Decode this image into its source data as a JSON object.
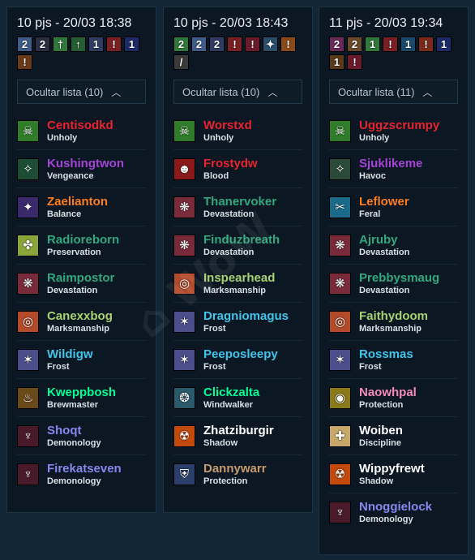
{
  "columns": [
    {
      "title": "10 pjs - 20/03 18:38",
      "toggle_label": "Ocultar lista (10)",
      "badges": [
        {
          "text": "2",
          "color": "#3f5d8a",
          "icon": "dk-rune-2"
        },
        {
          "text": "2",
          "color": "#2a2f45",
          "icon": "rune-2"
        },
        {
          "text": "†",
          "color": "#2f7a3a",
          "icon": "sword-icon"
        },
        {
          "text": "↑",
          "color": "#265e33",
          "icon": "green-arrow-icon"
        },
        {
          "text": "1",
          "color": "#2e3d63",
          "icon": "rune-1"
        },
        {
          "text": "!",
          "color": "#7a1f24",
          "icon": "red-mark-icon"
        },
        {
          "text": "1",
          "color": "#1c2c6b",
          "icon": "purple-rune-1"
        },
        {
          "text": "!",
          "color": "#6b3a1a",
          "icon": "orange-mark-icon"
        }
      ],
      "players": [
        {
          "name": "Centisodkd",
          "spec": "Unholy",
          "color": "#e8242f",
          "icon_bg": "#2f7d2a",
          "glyph": "☠",
          "icon": "unholy-icon"
        },
        {
          "name": "Kushingtwon",
          "spec": "Vengeance",
          "color": "#a544d6",
          "icon_bg": "#1d4e35",
          "glyph": "✧",
          "icon": "vengeance-icon"
        },
        {
          "name": "Zaelianton",
          "spec": "Balance",
          "color": "#ff7d1a",
          "icon_bg": "#3a2a6b",
          "glyph": "✦",
          "icon": "balance-icon"
        },
        {
          "name": "Radioreborn",
          "spec": "Preservation",
          "color": "#2fa87e",
          "icon_bg": "#8aa63a",
          "glyph": "✤",
          "icon": "preservation-icon"
        },
        {
          "name": "Raimpostor",
          "spec": "Devastation",
          "color": "#2fa87e",
          "icon_bg": "#7a2b3a",
          "glyph": "❋",
          "icon": "devastation-icon"
        },
        {
          "name": "Canexxbog",
          "spec": "Marksmanship",
          "color": "#a9d271",
          "icon_bg": "#b34a2a",
          "glyph": "◎",
          "icon": "marksmanship-icon"
        },
        {
          "name": "Wildigw",
          "spec": "Frost",
          "color": "#3fc6ea",
          "icon_bg": "#4a4f8c",
          "glyph": "✶",
          "icon": "frost-icon"
        },
        {
          "name": "Kweppbosh",
          "spec": "Brewmaster",
          "color": "#00ff96",
          "icon_bg": "#6b4a1a",
          "glyph": "♨",
          "icon": "brewmaster-icon"
        },
        {
          "name": "Shoqt",
          "spec": "Demonology",
          "color": "#8788ee",
          "icon_bg": "#4a1a2a",
          "glyph": "♆",
          "icon": "demonology-icon"
        },
        {
          "name": "Firekatseven",
          "spec": "Demonology",
          "color": "#8788ee",
          "icon_bg": "#4a1a2a",
          "glyph": "♆",
          "icon": "demonology-icon"
        }
      ]
    },
    {
      "title": "10 pjs - 20/03 18:43",
      "toggle_label": "Ocultar lista (10)",
      "badges": [
        {
          "text": "2",
          "color": "#2f7a3a",
          "icon": "green-rune-2"
        },
        {
          "text": "2",
          "color": "#3f5d8a",
          "icon": "dk-rune-2"
        },
        {
          "text": "2",
          "color": "#2e3d63",
          "icon": "rune-2"
        },
        {
          "text": "!",
          "color": "#7a1f24",
          "icon": "red-mark-icon"
        },
        {
          "text": "!",
          "color": "#6b1a2a",
          "icon": "red-mark-icon"
        },
        {
          "text": "✦",
          "color": "#2a4f6b",
          "icon": "ice-icon"
        },
        {
          "text": "!",
          "color": "#8a4a1a",
          "icon": "orange-mark-icon"
        },
        {
          "text": "/",
          "color": "#3a3a3a",
          "icon": "blade-icon"
        }
      ],
      "players": [
        {
          "name": "Worstxd",
          "spec": "Unholy",
          "color": "#e8242f",
          "icon_bg": "#2f7d2a",
          "glyph": "☠",
          "icon": "unholy-icon"
        },
        {
          "name": "Frostydw",
          "spec": "Blood",
          "color": "#e8242f",
          "icon_bg": "#8a1a1a",
          "glyph": "☻",
          "icon": "blood-icon"
        },
        {
          "name": "Thanervoker",
          "spec": "Devastation",
          "color": "#2fa87e",
          "icon_bg": "#7a2b3a",
          "glyph": "❋",
          "icon": "devastation-icon"
        },
        {
          "name": "Finduzbreath",
          "spec": "Devastation",
          "color": "#2fa87e",
          "icon_bg": "#7a2b3a",
          "glyph": "❋",
          "icon": "devastation-icon"
        },
        {
          "name": "Inspearhead",
          "spec": "Marksmanship",
          "color": "#a9d271",
          "icon_bg": "#b34a2a",
          "glyph": "◎",
          "icon": "marksmanship-icon"
        },
        {
          "name": "Dragniomagus",
          "spec": "Frost",
          "color": "#3fc6ea",
          "icon_bg": "#4a4f8c",
          "glyph": "✶",
          "icon": "frost-icon"
        },
        {
          "name": "Peeposleepy",
          "spec": "Frost",
          "color": "#3fc6ea",
          "icon_bg": "#4a4f8c",
          "glyph": "✶",
          "icon": "frost-icon"
        },
        {
          "name": "Clickzalta",
          "spec": "Windwalker",
          "color": "#00ff96",
          "icon_bg": "#2a5a6b",
          "glyph": "❂",
          "icon": "windwalker-icon"
        },
        {
          "name": "Zhatziburgir",
          "spec": "Shadow",
          "color": "#ffffff",
          "icon_bg": "#c24a0a",
          "glyph": "☢",
          "icon": "shadow-icon"
        },
        {
          "name": "Dannywarr",
          "spec": "Protection",
          "color": "#c69b6d",
          "icon_bg": "#2a3f6b",
          "glyph": "⛨",
          "icon": "protection-icon"
        }
      ]
    },
    {
      "title": "11 pjs - 20/03 19:34",
      "toggle_label": "Ocultar lista (11)",
      "badges": [
        {
          "text": "2",
          "color": "#6b2a5a",
          "icon": "purple-rune-2"
        },
        {
          "text": "2",
          "color": "#6b4a2a",
          "icon": "bronze-rune-2"
        },
        {
          "text": "1",
          "color": "#2f7a3a",
          "icon": "green-rune-1"
        },
        {
          "text": "!",
          "color": "#7a1f24",
          "icon": "red-mark-icon"
        },
        {
          "text": "1",
          "color": "#1a4a6b",
          "icon": "teal-rune-1"
        },
        {
          "text": "!",
          "color": "#7a2a1a",
          "icon": "red-mark-icon"
        },
        {
          "text": "1",
          "color": "#1c2c6b",
          "icon": "purple-rune-1"
        },
        {
          "text": "1",
          "color": "#5a3a1a",
          "icon": "gold-rune-1"
        },
        {
          "text": "!",
          "color": "#6b1a2a",
          "icon": "red-mark-icon"
        }
      ],
      "players": [
        {
          "name": "Uggzscrumpy",
          "spec": "Unholy",
          "color": "#e8242f",
          "icon_bg": "#2f7d2a",
          "glyph": "☠",
          "icon": "unholy-icon"
        },
        {
          "name": "Sjuklikeme",
          "spec": "Havoc",
          "color": "#a544d6",
          "icon_bg": "#2a4a3a",
          "glyph": "✧",
          "icon": "havoc-icon"
        },
        {
          "name": "Leflower",
          "spec": "Feral",
          "color": "#ff7d1a",
          "icon_bg": "#1a6b8a",
          "glyph": "✂",
          "icon": "feral-icon"
        },
        {
          "name": "Ajruby",
          "spec": "Devastation",
          "color": "#2fa87e",
          "icon_bg": "#7a2b3a",
          "glyph": "❋",
          "icon": "devastation-icon"
        },
        {
          "name": "Prebbysmaug",
          "spec": "Devastation",
          "color": "#2fa87e",
          "icon_bg": "#7a2b3a",
          "glyph": "❋",
          "icon": "devastation-icon"
        },
        {
          "name": "Faithydoom",
          "spec": "Marksmanship",
          "color": "#a9d271",
          "icon_bg": "#b34a2a",
          "glyph": "◎",
          "icon": "marksmanship-icon"
        },
        {
          "name": "Rossmas",
          "spec": "Frost",
          "color": "#3fc6ea",
          "icon_bg": "#4a4f8c",
          "glyph": "✶",
          "icon": "frost-icon"
        },
        {
          "name": "Naowhpal",
          "spec": "Protection",
          "color": "#f48cba",
          "icon_bg": "#8a7a1a",
          "glyph": "◉",
          "icon": "paladin-protection-icon"
        },
        {
          "name": "Woiben",
          "spec": "Discipline",
          "color": "#ffffff",
          "icon_bg": "#c8a86a",
          "glyph": "✚",
          "icon": "discipline-icon"
        },
        {
          "name": "Wippyfrewt",
          "spec": "Shadow",
          "color": "#ffffff",
          "icon_bg": "#c24a0a",
          "glyph": "☢",
          "icon": "shadow-icon"
        },
        {
          "name": "Nnoggielock",
          "spec": "Demonology",
          "color": "#8788ee",
          "icon_bg": "#4a1a2a",
          "glyph": "♆",
          "icon": "demonology-icon"
        }
      ]
    }
  ]
}
